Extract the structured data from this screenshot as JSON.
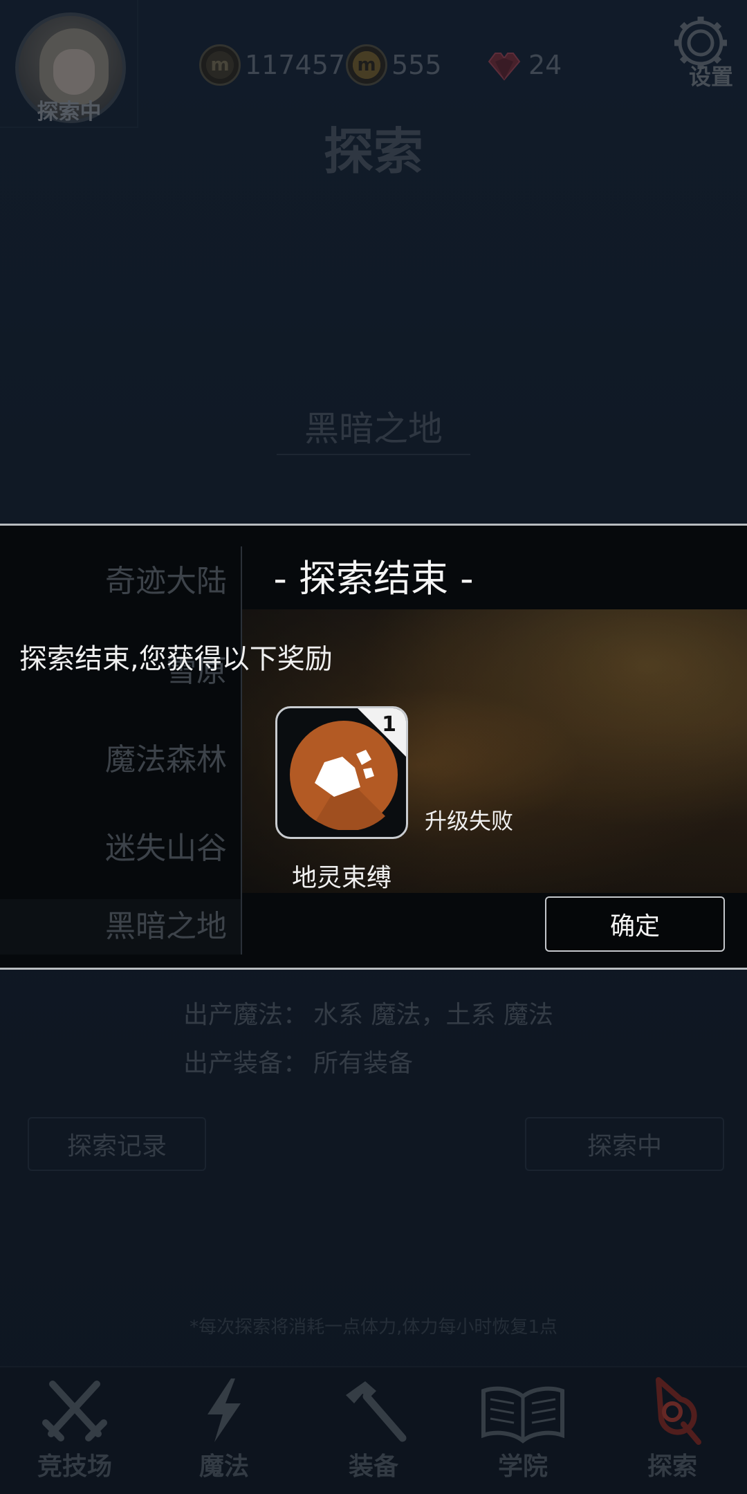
{
  "header": {
    "avatar_status": "探索中",
    "coins": "117457",
    "gold_coins": "555",
    "hearts": "24",
    "settings_label": "设置",
    "page_title": "探索"
  },
  "region": {
    "current": "黑暗之地",
    "produce_magic_label": "出产魔法：",
    "produce_magic_value": "水系 魔法，土系 魔法",
    "produce_equipment_label": "出产装备：",
    "produce_equipment_value": "所有装备"
  },
  "regions_list": [
    {
      "label": "奇迹大陆"
    },
    {
      "label": "雪原"
    },
    {
      "label": "魔法森林"
    },
    {
      "label": "迷失山谷"
    },
    {
      "label": "黑暗之地"
    }
  ],
  "buttons": {
    "history": "探索记录",
    "exploring": "探索中"
  },
  "footnote": "*每次探索将消耗一点体力,体力每小时恢复1点",
  "tabs": [
    {
      "label": "竞技场",
      "icon": "crossed-swords-icon"
    },
    {
      "label": "魔法",
      "icon": "lightning-icon"
    },
    {
      "label": "装备",
      "icon": "hammer-icon"
    },
    {
      "label": "学院",
      "icon": "open-book-icon"
    },
    {
      "label": "探索",
      "icon": "compass-icon",
      "active": true
    }
  ],
  "modal": {
    "title": "- 探索结束 -",
    "message": "探索结束,您获得以下奖励",
    "reward": {
      "name": "地灵束缚",
      "count": "1",
      "status": "升级失败",
      "icon": "earth-rock-icon",
      "color": "#b35a24"
    },
    "confirm_label": "确定"
  },
  "colors": {
    "accent_active_tab": "#c0392b",
    "modal_border": "#b8bcc0"
  }
}
